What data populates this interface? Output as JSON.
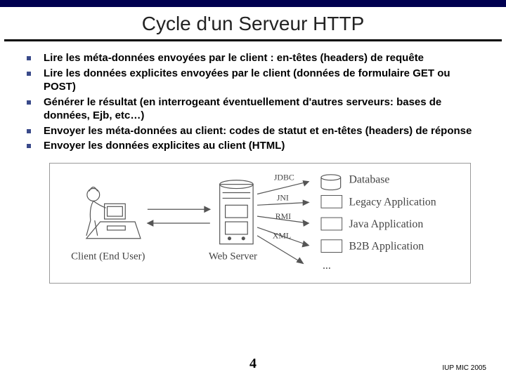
{
  "title": "Cycle d'un Serveur HTTP",
  "bullets": [
    "Lire les méta-données envoyées par le client : en-têtes (headers) de requête",
    "Lire les données explicites envoyées par le client (données de formulaire GET ou POST)",
    "Générer le résultat (en interrogeant éventuellement d'autres serveurs: bases de données, Ejb, etc…)",
    "Envoyer les méta-données au client: codes de statut et en-têtes (headers) de réponse",
    "Envoyer les données explicites au client (HTML)"
  ],
  "diagram": {
    "client_label": "Client (End User)",
    "server_label": "Web Server",
    "protocols": [
      "JDBC",
      "JNI",
      "RMI",
      "XML"
    ],
    "targets": [
      "Database",
      "Legacy Application",
      "Java Application",
      "B2B Application",
      "..."
    ]
  },
  "page_number": "4",
  "source": "IUP MIC 2005"
}
